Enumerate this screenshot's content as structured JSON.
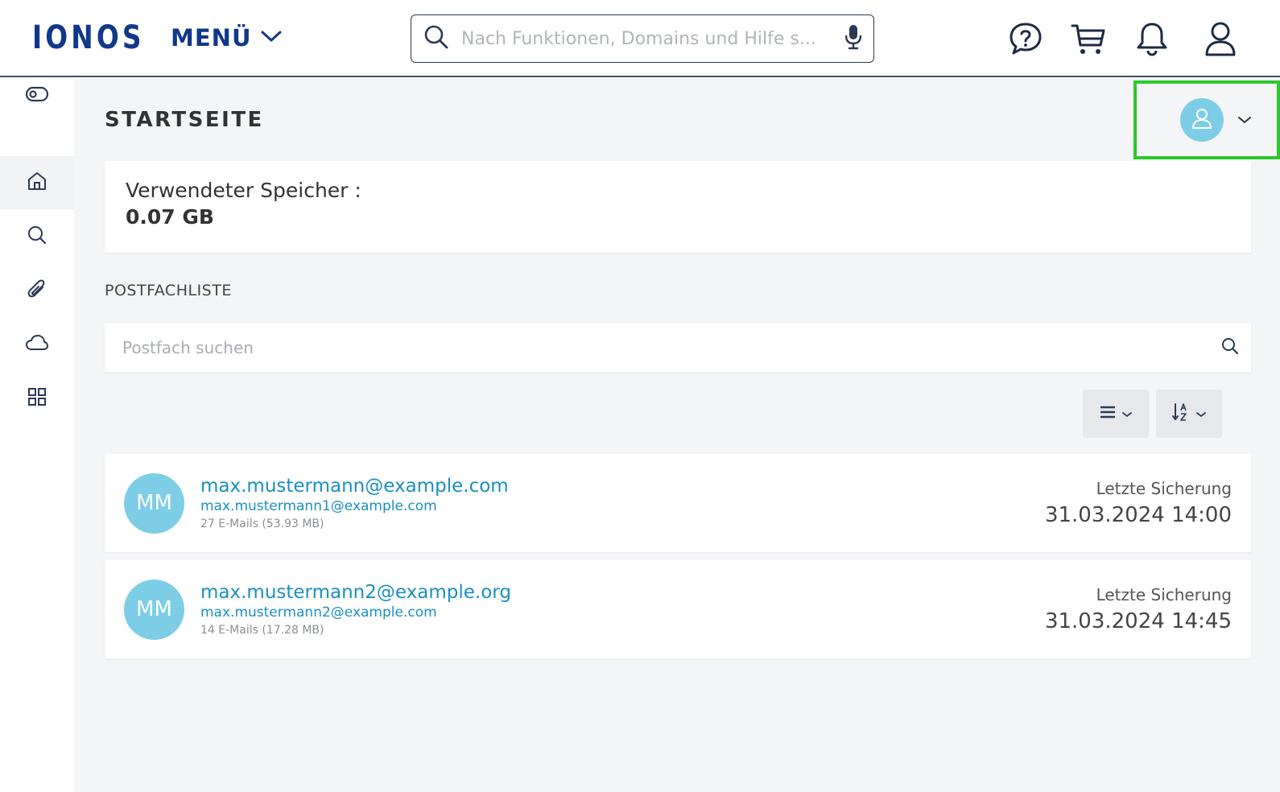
{
  "header": {
    "logo": "IONOS",
    "menu_label": "MENÜ",
    "search_placeholder": "Nach Funktionen, Domains und Hilfe s..."
  },
  "sidebar": {
    "items": [
      {
        "name": "toggle-icon"
      },
      {
        "name": "home-icon",
        "active": true
      },
      {
        "name": "search-icon"
      },
      {
        "name": "paperclip-icon"
      },
      {
        "name": "cloud-icon"
      },
      {
        "name": "grid-icon"
      }
    ]
  },
  "main": {
    "title": "STARTSEITE",
    "storage": {
      "label": "Verwendeter Speicher :",
      "value": "0.07 GB"
    },
    "mailbox_section_title": "POSTFACHLISTE",
    "mailbox_search_placeholder": "Postfach suchen",
    "mailboxes": [
      {
        "initials": "MM",
        "email": "max.mustermann@example.com",
        "alias": "max.mustermann1@example.com",
        "count": "27 E-Mails (53.93 MB)",
        "backup_label": "Letzte Sicherung",
        "backup_date": "31.03.2024 14:00"
      },
      {
        "initials": "MM",
        "email": "max.mustermann2@example.org",
        "alias": "max.mustermann2@example.com",
        "count": "14 E-Mails (17.28 MB)",
        "backup_label": "Letzte Sicherung",
        "backup_date": "31.03.2024 14:45"
      }
    ]
  },
  "colors": {
    "brand": "#11388a",
    "link": "#1a8fc1",
    "avatar": "#7ecde6",
    "highlight": "#2ec72e"
  }
}
